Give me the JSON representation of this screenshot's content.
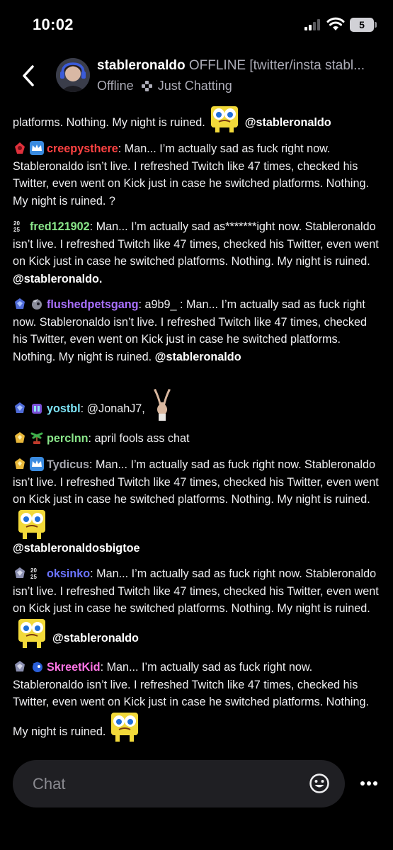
{
  "status_bar": {
    "time": "10:02",
    "battery": "5"
  },
  "header": {
    "channel_name": "stableronaldo",
    "stream_title": " OFFLINE [twitter/insta stabl...",
    "status": "Offline",
    "category": "Just Chatting"
  },
  "chat": {
    "messages": [
      {
        "text": "platforms. Nothing. My night is ruined.",
        "mention": "@stableronaldo"
      },
      {
        "user": "creepysthere",
        "user_color": "#ff4242",
        "text": ": Man... I’m actually sad as fuck right now. Stableronaldo isn’t live. I refreshed Twitch like 47 times, checked his Twitter, even went on Kick just in case he switched platforms. Nothing. My night is ruined. ?"
      },
      {
        "user": "fred121902",
        "user_color": "#8ae68a",
        "text": ": Man... I’m actually sad as*******ight now. Stableronaldo isn’t live. I refreshed Twitch like 47 times, checked his Twitter, even went on Kick just in case he switched platforms. Nothing. My night is ruined.",
        "mention": "@stableronaldo."
      },
      {
        "user": "flushedpetsgang",
        "user_color": "#a970ff",
        "text": ": a9b9_ : Man... I’m actually sad as fuck right now. Stableronaldo isn’t live. I refreshed Twitch like 47 times, checked his Twitter, even went on Kick just in case he switched platforms. Nothing. My night is ruined.",
        "mention": "@stableronaldo"
      },
      {
        "user": "yostbl",
        "user_color": "#7de3f5",
        "text": ": @JonahJ7,"
      },
      {
        "user": "perclnn",
        "user_color": "#8ae68a",
        "text": ": april fools ass chat"
      },
      {
        "user": "Tydicus",
        "user_color": "#a6a6ae",
        "text": ": Man... I’m actually sad as fuck right now. Stableronaldo isn’t live. I refreshed Twitch like 47 times, checked his Twitter, even went on Kick just in case he switched platforms. Nothing. My night is ruined.",
        "mention": "@stableronaldosbigtoe"
      },
      {
        "user": "oksinko",
        "user_color": "#6b74ff",
        "text": ": Man... I’m actually sad as fuck right now. Stableronaldo isn’t live. I refreshed Twitch like 47 times, checked his Twitter, even went on Kick just in case he switched platforms. Nothing. My night is ruined.",
        "mention": "@stableronaldo"
      },
      {
        "user": "SkreetKid",
        "user_color": "#ff75e6",
        "text": ": Man... I’m actually sad as fuck right now. Stableronaldo isn’t live. I refreshed Twitch like 47 times, checked his Twitter, even went on Kick just in case he switched platforms. Nothing. My night is ruined."
      }
    ]
  },
  "input": {
    "placeholder": "Chat"
  },
  "icons": {
    "back": "chevron-left-icon",
    "game": "gamepad-icon",
    "emoji": "smiley-icon",
    "more": "more-dots-icon",
    "emote": "sad-spongebob-emote",
    "crown_badge": "crown-badge",
    "sub_badge": "sub-badge"
  },
  "colors": {
    "background": "#000000",
    "input_bg": "#1f1f23",
    "muted": "#adadb8"
  }
}
